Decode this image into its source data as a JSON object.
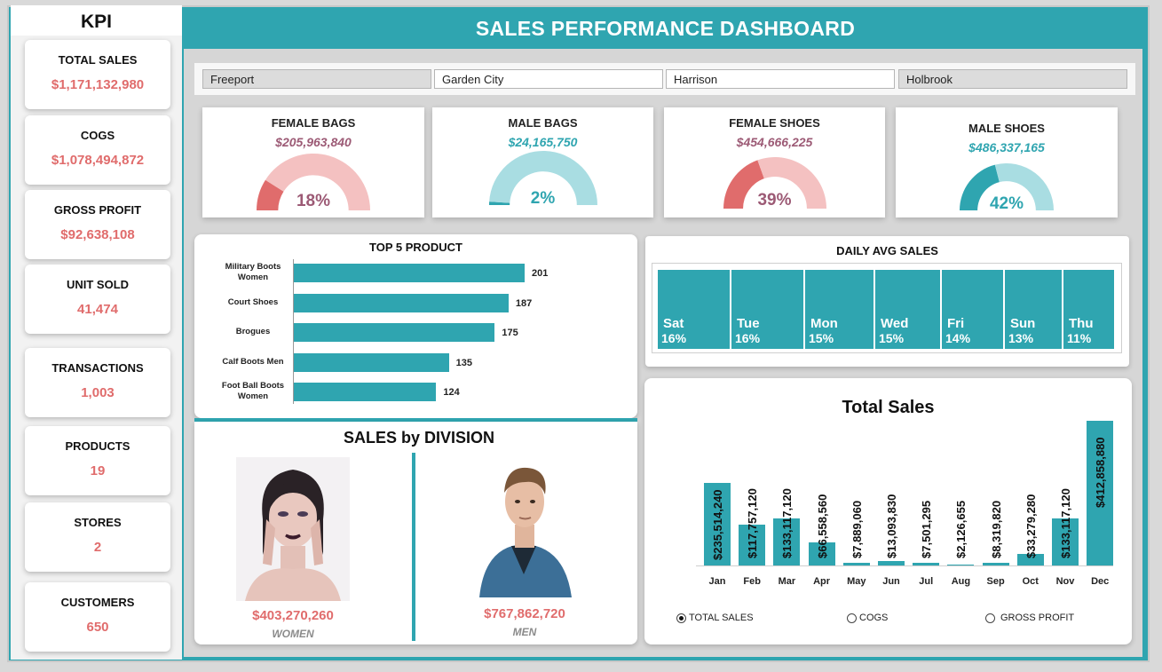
{
  "header": {
    "title": "SALES  PERFORMANCE DASHBOARD"
  },
  "kpi": {
    "title": "KPI",
    "items": [
      {
        "label": "TOTAL SALES",
        "value": "$1,171,132,980"
      },
      {
        "label": "COGS",
        "value": "$1,078,494,872"
      },
      {
        "label": "GROSS PROFIT",
        "value": "$92,638,108"
      },
      {
        "label": "UNIT SOLD",
        "value": "41,474"
      },
      {
        "label": "TRANSACTIONS",
        "value": "1,003"
      },
      {
        "label": "PRODUCTS",
        "value": "19"
      },
      {
        "label": "STORES",
        "value": "2"
      },
      {
        "label": "CUSTOMERS",
        "value": "650"
      }
    ]
  },
  "slicer": {
    "items": [
      {
        "label": "Freeport",
        "selected": false
      },
      {
        "label": "Garden City",
        "selected": true
      },
      {
        "label": "Harrison",
        "selected": true
      },
      {
        "label": "Holbrook",
        "selected": false
      }
    ]
  },
  "gauges": [
    {
      "title": "FEMALE BAGS",
      "value": "$205,963,840",
      "pct_label": "18%",
      "pct": 18,
      "color": "#e06c6c",
      "track": "#f4c1c1",
      "value_color": "#9c5a75"
    },
    {
      "title": "MALE BAGS",
      "value": "$24,165,750",
      "pct_label": "2%",
      "pct": 2,
      "color": "#2fa5b0",
      "track": "#a9dde2",
      "value_color": "#2fa5b0"
    },
    {
      "title": "FEMALE SHOES",
      "value": "$454,666,225",
      "pct_label": "39%",
      "pct": 39,
      "color": "#e06c6c",
      "track": "#f4c1c1",
      "value_color": "#9c5a75"
    },
    {
      "title": "MALE SHOES",
      "value": "$486,337,165",
      "pct_label": "42%",
      "pct": 42,
      "color": "#2fa5b0",
      "track": "#a9dde2",
      "value_color": "#2fa5b0"
    }
  ],
  "top_products": {
    "title": "TOP 5 PRODUCT",
    "items": [
      {
        "name": "Military Boots Women",
        "value": 201
      },
      {
        "name": "Court Shoes",
        "value": 187
      },
      {
        "name": "Brogues",
        "value": 175
      },
      {
        "name": "Calf Boots Men",
        "value": 135
      },
      {
        "name": "Foot Ball Boots Women",
        "value": 124
      }
    ]
  },
  "daily_avg": {
    "title": "DAILY AVG SALES",
    "items": [
      {
        "day": "Sat",
        "pct": "16%"
      },
      {
        "day": "Tue",
        "pct": "16%"
      },
      {
        "day": "Mon",
        "pct": "15%"
      },
      {
        "day": "Wed",
        "pct": "15%"
      },
      {
        "day": "Fri",
        "pct": "14%"
      },
      {
        "day": "Sun",
        "pct": "13%"
      },
      {
        "day": "Thu",
        "pct": "11%"
      }
    ]
  },
  "division": {
    "title": "SALES by DIVISION",
    "women": {
      "value": "$403,270,260",
      "label": "WOMEN"
    },
    "men": {
      "value": "$767,862,720",
      "label": "MEN"
    }
  },
  "monthly": {
    "title": "Total Sales",
    "radio": [
      {
        "label": "TOTAL SALES",
        "checked": true
      },
      {
        "label": "COGS",
        "checked": false
      },
      {
        "label": "GROSS PROFIT",
        "checked": false
      }
    ]
  },
  "chart_data": [
    {
      "type": "bar",
      "title": "TOP 5 PRODUCT",
      "orientation": "horizontal",
      "categories": [
        "Military Boots Women",
        "Court Shoes",
        "Brogues",
        "Calf Boots Men",
        "Foot Ball Boots Women"
      ],
      "values": [
        201,
        187,
        175,
        135,
        124
      ]
    },
    {
      "type": "bar",
      "title": "Total Sales",
      "categories": [
        "Jan",
        "Feb",
        "Mar",
        "Apr",
        "May",
        "Jun",
        "Jul",
        "Aug",
        "Sep",
        "Oct",
        "Nov",
        "Dec"
      ],
      "values": [
        235514240,
        117757120,
        133117120,
        66558560,
        7889060,
        13093830,
        7501295,
        2126655,
        8319820,
        33279280,
        133117120,
        412858880
      ],
      "labels": [
        "$235,514,240",
        "$117,757,120",
        "$133,117,120",
        "$66,558,560",
        "$7,889,060",
        "$13,093,830",
        "$7,501,295",
        "$2,126,655",
        "$8,319,820",
        "$33,279,280",
        "$133,117,120",
        "$412,858,880"
      ]
    },
    {
      "type": "pie",
      "title": "FEMALE BAGS",
      "values": [
        18,
        82
      ]
    },
    {
      "type": "pie",
      "title": "MALE BAGS",
      "values": [
        2,
        98
      ]
    },
    {
      "type": "pie",
      "title": "FEMALE SHOES",
      "values": [
        39,
        61
      ]
    },
    {
      "type": "pie",
      "title": "MALE SHOES",
      "values": [
        42,
        58
      ]
    }
  ]
}
